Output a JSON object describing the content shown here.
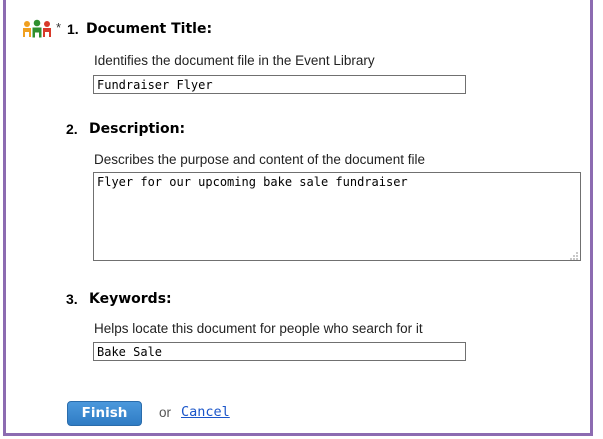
{
  "form": {
    "required_marker": "*",
    "fields": [
      {
        "number": "1.",
        "title": "Document Title:",
        "help": "Identifies the document file in the Event Library",
        "value": "Fundraiser Flyer"
      },
      {
        "number": "2.",
        "title": "Description:",
        "help": "Describes the purpose and content of the document file",
        "value": "Flyer for our upcoming bake sale fundraiser"
      },
      {
        "number": "3.",
        "title": "Keywords:",
        "help": "Helps locate this document for people who search for it",
        "value": "Bake Sale"
      }
    ]
  },
  "actions": {
    "finish_label": "Finish",
    "or_text": "or",
    "cancel_label": "Cancel"
  },
  "colors": {
    "frame": "#8c6bb1",
    "finish_button": "#3a88d0",
    "link": "#1a55c9"
  }
}
